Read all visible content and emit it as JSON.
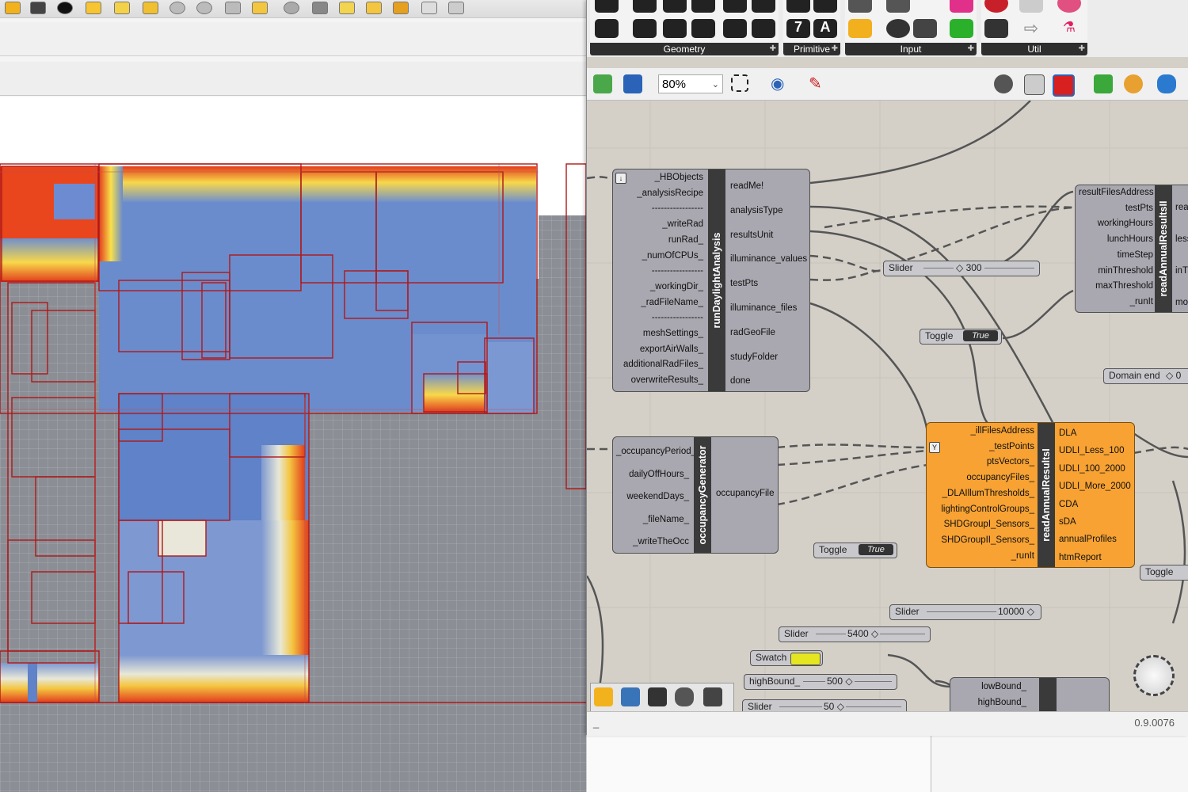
{
  "grasshopper": {
    "ribbon_groups": [
      "Geometry",
      "Primitive",
      "Input",
      "Util"
    ],
    "zoom": "80%",
    "version": "0.9.0076",
    "status_left": "_",
    "components": {
      "runDaylight": {
        "title": "runDaylightAnalysis",
        "inputs": [
          "_HBObjects",
          "_analysisRecipe",
          "-----------------",
          "_writeRad",
          "runRad_",
          "_numOfCPUs_",
          "-----------------",
          "_workingDir_",
          "_radFileName_",
          "-----------------",
          "meshSettings_",
          "exportAirWalls_",
          "additionalRadFiles_",
          "overwriteResults_"
        ],
        "outputs": [
          "readMe!",
          "analysisType",
          "resultsUnit",
          "illuminance_values",
          "testPts",
          "illuminance_files",
          "radGeoFile",
          "studyFolder",
          "done"
        ]
      },
      "occupancy": {
        "title": "occupancyGenerator",
        "inputs": [
          "_occupancyPeriod_",
          "dailyOffHours_",
          "weekendDays_",
          "_fileName_",
          "_writeTheOcc"
        ],
        "outputs": [
          "occupancyFile"
        ]
      },
      "readAnnualI": {
        "title": "readAnnualResultsI",
        "inputs": [
          "_illFilesAddress",
          "_testPoints",
          "ptsVectors_",
          "occupancyFiles_",
          "_DLAIllumThresholds_",
          "lightingControlGroups_",
          "SHDGroupI_Sensors_",
          "SHDGroupII_Sensors_",
          "_runIt"
        ],
        "outputs": [
          "DLA",
          "UDLI_Less_100",
          "UDLI_100_2000",
          "UDLI_More_2000",
          "CDA",
          "sDA",
          "annualProfiles",
          "htmReport"
        ]
      },
      "readAnnualII": {
        "title": "readAnnualResultsII",
        "inputs": [
          "resultFilesAddress",
          "testPts",
          "workingHours",
          "lunchHours",
          "timeStep",
          "minThreshold",
          "maxThreshold",
          "_runIt"
        ],
        "outputs": [
          "read",
          "less",
          "inTh",
          "mor"
        ]
      },
      "bottomComp": {
        "inputs": [
          "lowBound_",
          "highBound_"
        ]
      }
    },
    "widgets": {
      "slider300": {
        "label": "Slider",
        "value": "300"
      },
      "toggle1": {
        "label": "Toggle",
        "value": "True"
      },
      "domainEnd": {
        "label": "Domain end",
        "value": "0"
      },
      "toggle2": {
        "label": "Toggle",
        "value": "True"
      },
      "toggle3": {
        "label": "Toggle"
      },
      "slider10000": {
        "label": "Slider",
        "value": "10000"
      },
      "slider5400": {
        "label": "Slider",
        "value": "5400"
      },
      "swatch": {
        "label": "Swatch",
        "color": "#e6e620"
      },
      "highBound": {
        "label": "highBound_",
        "value": "500"
      },
      "slider50": {
        "label": "Slider",
        "value": "50"
      }
    }
  },
  "colors": {
    "accent_orange": "#f7a233",
    "heat_blue": "#6a8acc",
    "heat_red": "#e23c1c",
    "heat_yellow": "#f8e14a",
    "outline_red": "#b01818"
  }
}
